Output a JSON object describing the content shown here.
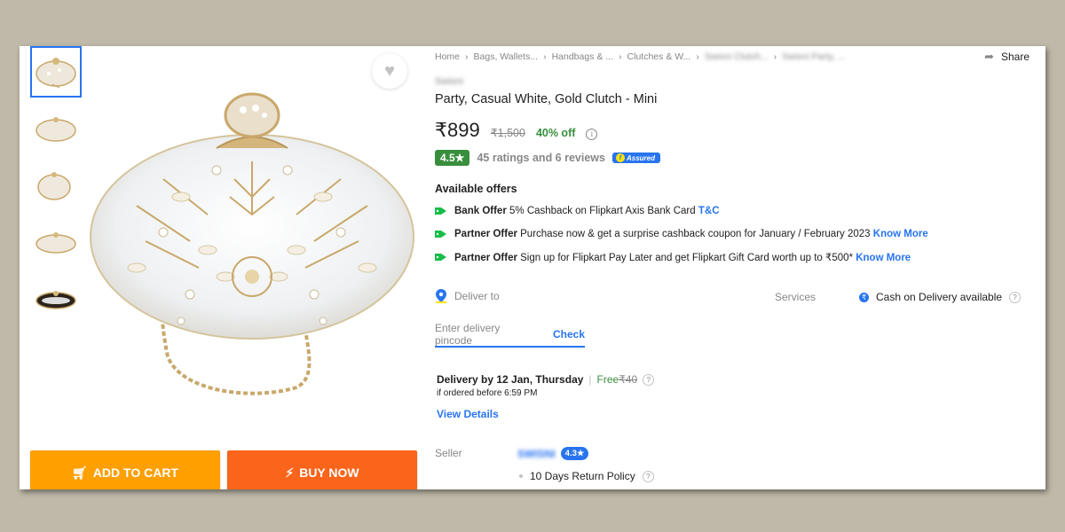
{
  "breadcrumbs": [
    "Home",
    "Bags, Wallets...",
    "Handbags & ...",
    "Clutches & W...",
    "Swisni Clutch...",
    "Swisni Party, ..."
  ],
  "share_label": "Share",
  "brand": "Swisni",
  "title": "Party, Casual White, Gold Clutch - Mini",
  "price": "₹899",
  "mrp": "₹1,500",
  "discount": "40% off",
  "rating": "4.5★",
  "rating_text": "45 ratings and 6 reviews",
  "assured_label": "Assured",
  "offers": {
    "heading": "Available offers",
    "items": [
      {
        "type": "Bank Offer",
        "text": "5% Cashback on Flipkart Axis Bank Card",
        "link": "T&C"
      },
      {
        "type": "Partner Offer",
        "text": "Purchase now & get a surprise cashback coupon for January / February 2023",
        "link": "Know More"
      },
      {
        "type": "Partner Offer",
        "text": "Sign up for Flipkart Pay Later and get Flipkart Gift Card worth up to ₹500*",
        "link": "Know More"
      }
    ]
  },
  "delivery": {
    "deliver_to": "Deliver to",
    "services_label": "Services",
    "cod": "Cash on Delivery available",
    "pincode_placeholder": "Enter delivery pincode",
    "check": "Check",
    "delivery_by": "Delivery by 12 Jan, Thursday",
    "free": "Free",
    "charge": "₹40",
    "ordered_before": "if ordered before 6:59 PM",
    "view_details": "View Details"
  },
  "seller": {
    "label": "Seller",
    "name": "SWISNI",
    "rating": "4.3★",
    "return_policy": "10 Days Return Policy"
  },
  "buttons": {
    "add_to_cart": "ADD TO CART",
    "buy_now": "BUY NOW"
  },
  "colors": {
    "accent": "#2874f0",
    "cart": "#ff9f00",
    "buy": "#fb641b",
    "green": "#388e3c"
  }
}
